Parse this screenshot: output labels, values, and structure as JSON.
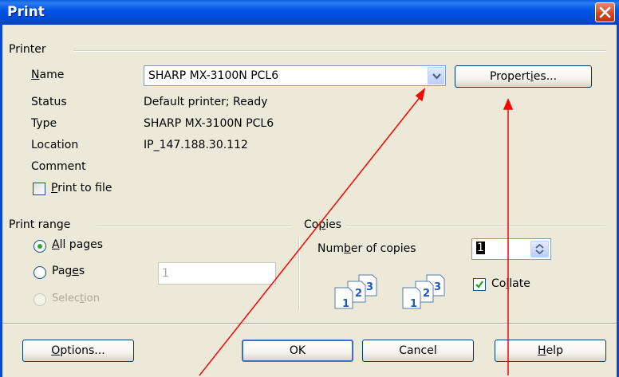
{
  "window": {
    "title": "Print"
  },
  "printer": {
    "group_label": "Printer",
    "name_label": "Name",
    "name_value": "SHARP MX-3100N PCL6",
    "properties_button": "Properties...",
    "status_label": "Status",
    "status_value": "Default printer; Ready",
    "type_label": "Type",
    "type_value": "SHARP MX-3100N PCL6",
    "location_label": "Location",
    "location_value": "IP_147.188.30.112",
    "comment_label": "Comment",
    "print_to_file_label": "Print to file",
    "print_to_file_checked": false
  },
  "print_range": {
    "group_label": "Print range",
    "all_pages_label": "All pages",
    "pages_label": "Pages",
    "pages_value": "1",
    "selection_label": "Selection",
    "selected": "All pages"
  },
  "copies": {
    "group_label": "Copies",
    "number_label": "Number of copies",
    "number_value": "1",
    "collate_label": "Collate",
    "collate_checked": true,
    "icon_pages": [
      "1",
      "2",
      "3"
    ]
  },
  "buttons": {
    "options": "Options...",
    "ok": "OK",
    "cancel": "Cancel",
    "help": "Help"
  },
  "colors": {
    "titlebar": "#0055e5",
    "dialog_bg": "#ece9d8",
    "annotation_arrow": "#ff0000"
  }
}
